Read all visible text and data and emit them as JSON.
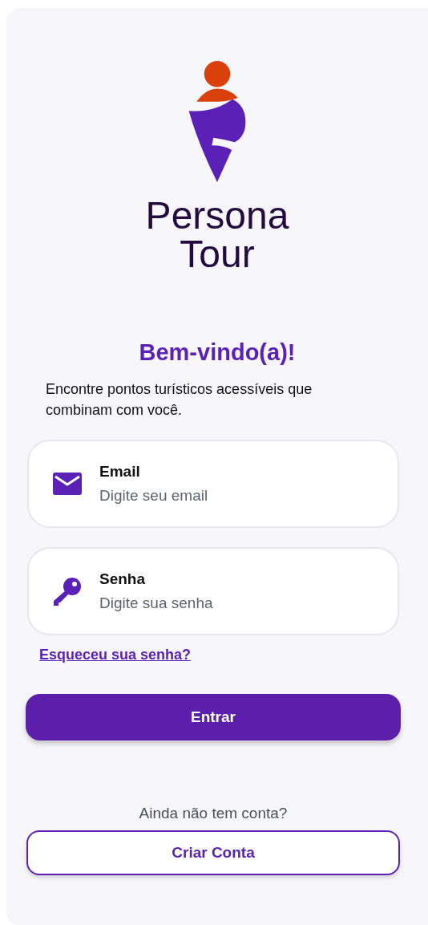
{
  "logo": {
    "line_1": "Persona",
    "line_2": "Tour"
  },
  "heading": "Bem-vindo(a)!",
  "description": "Encontre pontos turísticos acessíveis que combinam com você.",
  "fields": [
    {
      "kind": "email",
      "label": "Email",
      "placeholder": "Digite seu email"
    },
    {
      "kind": "password",
      "label": "Senha",
      "placeholder": "Digite sua senha"
    }
  ],
  "forgot_link": "Esqueceu sua senha?",
  "login_button": "Entrar",
  "signup_prompt": "Ainda não tem conta?",
  "signup_button": "Criar Conta"
}
